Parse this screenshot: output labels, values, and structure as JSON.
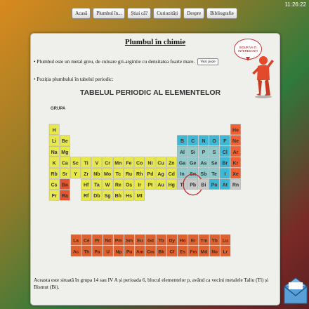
{
  "clock": "11:26:22",
  "nav": [
    "Acasă",
    "Plumbul în...",
    "Știai că?",
    "Curiozități",
    "Despre",
    "Bibliografie"
  ],
  "title": "Plumbul în chimie",
  "para1": "• Plumbul este un metal greu, de culoare gri-argintie cu densitatea foarte mare.",
  "more_button": "Vezi poze",
  "para2": "• Poziția plumbului în tabelul periodic:",
  "bubble": "SIGUR VA-ȚI INTERESANT!",
  "table": {
    "title": "TABELUL PERIODIC AL ELEMENTELOR",
    "group_label": "GRUPA",
    "rows": [
      [
        "H",
        "",
        "",
        "",
        "",
        "",
        "",
        "",
        "",
        "",
        "",
        "",
        "",
        "",
        "",
        "",
        "",
        "He"
      ],
      [
        "Li",
        "Be",
        "",
        "",
        "",
        "",
        "",
        "",
        "",
        "",
        "",
        "",
        "B",
        "C",
        "N",
        "O",
        "F",
        "Ne"
      ],
      [
        "Na",
        "Mg",
        "",
        "",
        "",
        "",
        "",
        "",
        "",
        "",
        "",
        "",
        "Al",
        "Si",
        "P",
        "S",
        "Cl",
        "Ar"
      ],
      [
        "K",
        "Ca",
        "Sc",
        "Ti",
        "V",
        "Cr",
        "Mn",
        "Fe",
        "Co",
        "Ni",
        "Cu",
        "Zn",
        "Ga",
        "Ge",
        "As",
        "Se",
        "Br",
        "Kr"
      ],
      [
        "Rb",
        "Sr",
        "Y",
        "Zr",
        "Nb",
        "Mo",
        "Tc",
        "Ru",
        "Rh",
        "Pd",
        "Ag",
        "Cd",
        "In",
        "Sn",
        "Sb",
        "Te",
        "I",
        "Xe"
      ],
      [
        "Cs",
        "Ba",
        "",
        "Hf",
        "Ta",
        "W",
        "Re",
        "Os",
        "Ir",
        "Pt",
        "Au",
        "Hg",
        "Tl",
        "Pb",
        "Bi",
        "Po",
        "At",
        "Rn"
      ],
      [
        "Fr",
        "Ra",
        "",
        "Rf",
        "Db",
        "Sg",
        "Bh",
        "Hs",
        "Mt",
        "",
        "",
        "",
        "",
        "",
        "",
        "",
        "",
        ""
      ]
    ],
    "lanthanides": [
      "La",
      "Ce",
      "Pr",
      "Nd",
      "Pm",
      "Sm",
      "Eu",
      "Gd",
      "Tb",
      "Dy",
      "Ho",
      "Er",
      "Tm",
      "Yb",
      "Lu"
    ],
    "actinides": [
      "Ac",
      "Th",
      "Pa",
      "U",
      "Np",
      "Pu",
      "Am",
      "Cm",
      "Bk",
      "Cf",
      "Es",
      "Fm",
      "Md",
      "No",
      "Lr"
    ],
    "highlight": "Pb",
    "colors": {
      "alkali": "#e2552e",
      "transition": "#e8e84a",
      "metalloid": "#8fc9c9",
      "nonmetal": "#3db9d6",
      "noble": "#f06030",
      "other": "#c8c8c8",
      "lanthanide": "#e0602e",
      "highlight": "#c62b2b"
    }
  },
  "bottom_text": "Aceasta este situată în grupa 14 sau IV A și perioada 6, blocul elementelor p, având ca vecini metalele Taliu (Tl) și Bismut (Bi)."
}
